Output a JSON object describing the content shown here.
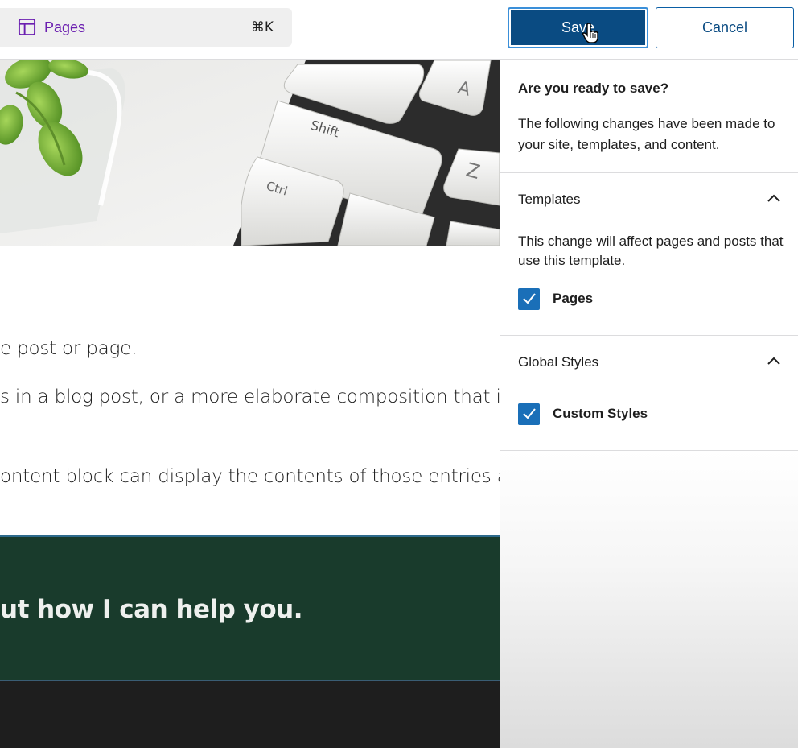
{
  "topbar": {
    "command_label": "Pages",
    "command_icon": "layout-icon",
    "shortcut": "⌘K"
  },
  "content": {
    "para1": "e post or page.",
    "para2": "s in a blog post, or a more elaborate composition that includ",
    "para3": "ontent block can display the contents of those entries as we",
    "cta": "ut how I can help you."
  },
  "hero_keyboard": {
    "key_shift": "Shift",
    "key_ctrl": "Ctrl",
    "key_a": "A",
    "key_z": "Z"
  },
  "save_panel": {
    "save_label": "Save",
    "cancel_label": "Cancel",
    "intro_title": "Are you ready to save?",
    "intro_text": "The following changes have been made to your site, templates, and content.",
    "templates": {
      "title": "Templates",
      "description": "This change will affect pages and posts that use this template.",
      "item_label": "Pages",
      "checked": true
    },
    "global_styles": {
      "title": "Global Styles",
      "item_label": "Custom Styles",
      "checked": true
    }
  },
  "colors": {
    "primary": "#0a4b82",
    "checkbox": "#1a6fb8",
    "accent_purple": "#6b1fb0",
    "cta_background": "#193b2c"
  }
}
